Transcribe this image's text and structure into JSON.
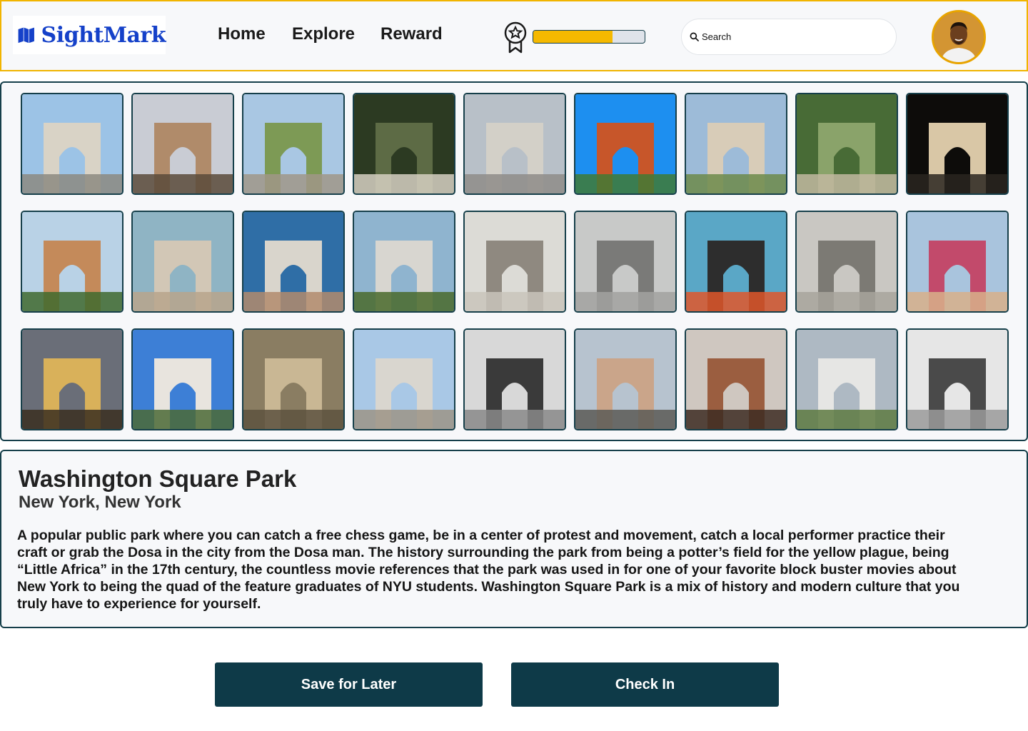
{
  "header": {
    "logo_text": "SightMark",
    "nav": [
      "Home",
      "Explore",
      "Reward"
    ],
    "reward_progress": 0.71,
    "search_placeholder": "Search",
    "colors": {
      "accent": "#f1b400",
      "brand": "#1541c9",
      "dark": "#0e3a48"
    }
  },
  "gallery": {
    "images": [
      "washington-square-arch-crowd",
      "arch-with-tower-street",
      "park-path-trees",
      "statue-silhouette",
      "arch-detail-sky",
      "red-brick-building-blue-sky",
      "woman-in-front-of-arch",
      "trees-with-column",
      "arch-at-night",
      "arch-side-empire-state",
      "arch-underside-sky",
      "arch-with-fountain-plaza",
      "view-through-arch-street",
      "arch-carving-detail",
      "arch-frontal-street-view",
      "protest-black-lives-matter",
      "bw-park-tree",
      "crowd-fountain",
      "arch-at-dusk",
      "fountain-with-arch",
      "arch-coffered-ceiling",
      "arch-corner-detail",
      "bw-performer",
      "women-sitting-plaza",
      "arch-street-evening",
      "fountain-and-arch-green",
      "bw-fountain-figure"
    ]
  },
  "place": {
    "title": "Washington Square Park",
    "location": "New York, New York",
    "description": "A popular public park where you can catch a free chess game, be in a center of protest and movement, catch a local performer practice their craft or grab the Dosa in the city from the Dosa man. The history surrounding the park from being a potter’s field for the yellow plague, being “Little Africa” in the 17th century, the countless movie references that the park was used in for one of your favorite block buster movies about New York to being the quad of the feature graduates of NYU students. Washington Square Park is a mix of history and modern culture that you truly have to experience for yourself."
  },
  "actions": {
    "save_label": "Save for Later",
    "checkin_label": "Check In"
  }
}
